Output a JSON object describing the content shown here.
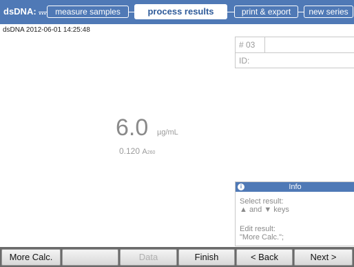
{
  "header": {
    "app_title": "dsDNA: ...",
    "steps": [
      {
        "label": "measure samples",
        "active": false
      },
      {
        "label": "process results",
        "active": true
      },
      {
        "label": "print & export",
        "active": false
      },
      {
        "label": "new series",
        "active": false
      }
    ]
  },
  "timestamp": "dsDNA 2012-06-01 14:25:48",
  "sample": {
    "number_label": "# 03",
    "id_label": "ID:"
  },
  "result": {
    "value": "6.0",
    "unit": "µg/mL",
    "absorbance_value": "0.120",
    "absorbance_unit": "A",
    "absorbance_subscript": "260"
  },
  "info": {
    "icon": "info-icon",
    "title": "Info",
    "line1": "Select result:",
    "line2": "▲ and ▼ keys",
    "line3": "Edit result:",
    "line4": "\"More Calc.\";"
  },
  "softkeys": {
    "more_calc": "More Calc.",
    "blank": "",
    "data": "Data",
    "finish": "Finish",
    "back": "< Back",
    "next": "Next >"
  },
  "colors": {
    "header_blue": "#4f79b6",
    "softkey_bar": "#6a6a6a"
  }
}
